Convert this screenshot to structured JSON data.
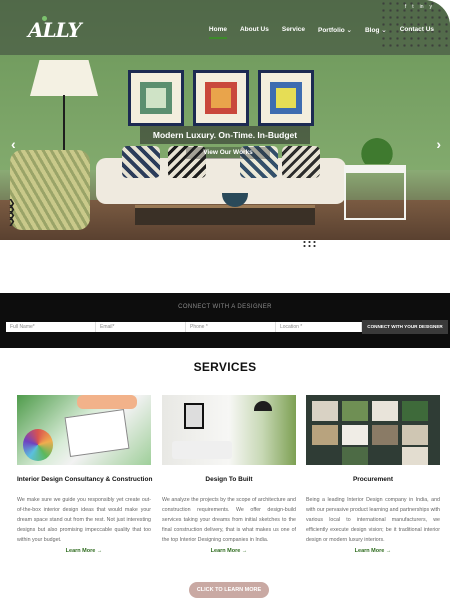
{
  "brand": {
    "logo_text": "ALLY"
  },
  "nav": {
    "items": [
      {
        "label": "Home",
        "active": true
      },
      {
        "label": "About Us"
      },
      {
        "label": "Service"
      },
      {
        "label": "Portfolio ⌄"
      },
      {
        "label": "Blog ⌄"
      },
      {
        "label": "Contact Us"
      }
    ]
  },
  "social": [
    "f",
    "t",
    "in",
    "y"
  ],
  "hero": {
    "title": "Modern Luxury. On-Time. In-Budget",
    "link": "View Our Works",
    "prev_icon": "‹",
    "next_icon": "›"
  },
  "connect": {
    "title": "CONNECT WITH A DESIGNER",
    "fields": [
      {
        "placeholder": "Full Name*"
      },
      {
        "placeholder": "Email*"
      },
      {
        "placeholder": "Phone *"
      },
      {
        "placeholder": "Location *"
      }
    ],
    "button": "CONNECT WITH YOUR DESIGNER"
  },
  "services": {
    "heading": "SERVICES",
    "cards": [
      {
        "title": "Interior Design Consultancy & Construction",
        "text": "We make sure we guide you responsibly yet create out-of-the-box interior design ideas that would make your dream space stand out from the rest. Not just interesting designs but also promising impeccable quality that too within your budget.",
        "link": "Learn More →"
      },
      {
        "title": "Design To Built",
        "text": "We analyze the projects by the scope of architecture and construction requirements. We offer design-build services taking your dreams from initial sketches to the final construction delivery, that is what makes us one of the top Interior Designing companies in India.",
        "link": "Learn More →"
      },
      {
        "title": "Procurement",
        "text": "Being a leading Interior Design company in India, and with our pervasive product learning and partnerships with various local to international manufacturers, we efficiently execute design vision; be it traditional interior design or modern luxury interiors.",
        "link": "Learn More →"
      }
    ],
    "cta": "CLICK TO LEARN MORE"
  },
  "colors": {
    "accent": "#3d8b2a",
    "cta": "#c9a9a3",
    "connect_bg": "#0d0d0d"
  }
}
